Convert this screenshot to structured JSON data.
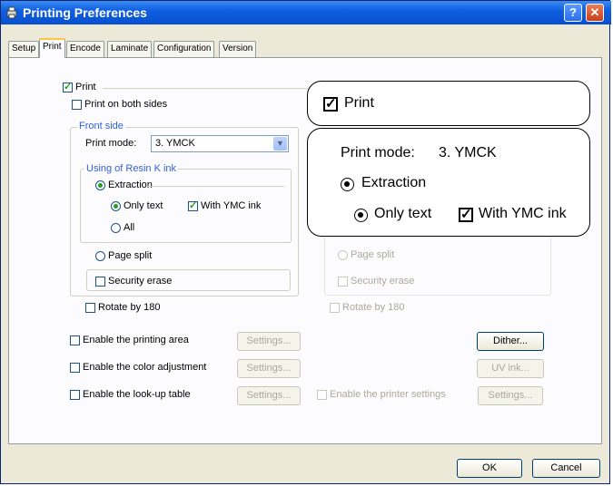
{
  "window": {
    "title": "Printing Preferences",
    "help_label": "?",
    "close_label": "✕"
  },
  "tabs": [
    {
      "label": "Setup",
      "active": false
    },
    {
      "label": "Print",
      "active": true
    },
    {
      "label": "Encode",
      "active": false
    },
    {
      "label": "Laminate",
      "active": false
    },
    {
      "label": "Configuration",
      "active": false
    },
    {
      "label": "Version",
      "active": false
    }
  ],
  "print": {
    "print_label": "Print",
    "both_sides_label": "Print on both sides",
    "front_side_label": "Front side",
    "print_mode_label": "Print mode:",
    "print_mode_value": "3. YMCK",
    "resin_group_label": "Using of Resin K ink",
    "extraction_label": "Extraction",
    "only_text_label": "Only text",
    "with_ymc_label": "With YMC ink",
    "all_label": "All",
    "page_split_label": "Page split",
    "security_erase_label": "Security erase",
    "rotate_label": "Rotate by 180"
  },
  "back_side": {
    "page_split_label": "Page split",
    "security_erase_label": "Security erase",
    "rotate_label": "Rotate by 180"
  },
  "options": {
    "printing_area_label": "Enable the printing area",
    "color_adjustment_label": "Enable the color adjustment",
    "lookup_table_label": "Enable the look-up table",
    "printer_settings_label": "Enable the printer settings",
    "settings_label": "Settings...",
    "dither_label": "Dither...",
    "uv_ink_label": "UV ink..."
  },
  "footer": {
    "ok_label": "OK",
    "cancel_label": "Cancel"
  },
  "callouts": {
    "print_label": "Print",
    "print_mode_label": "Print mode:",
    "print_mode_value": "3. YMCK",
    "extraction_label": "Extraction",
    "only_text_label": "Only text",
    "with_ymc_label": "With YMC ink"
  }
}
